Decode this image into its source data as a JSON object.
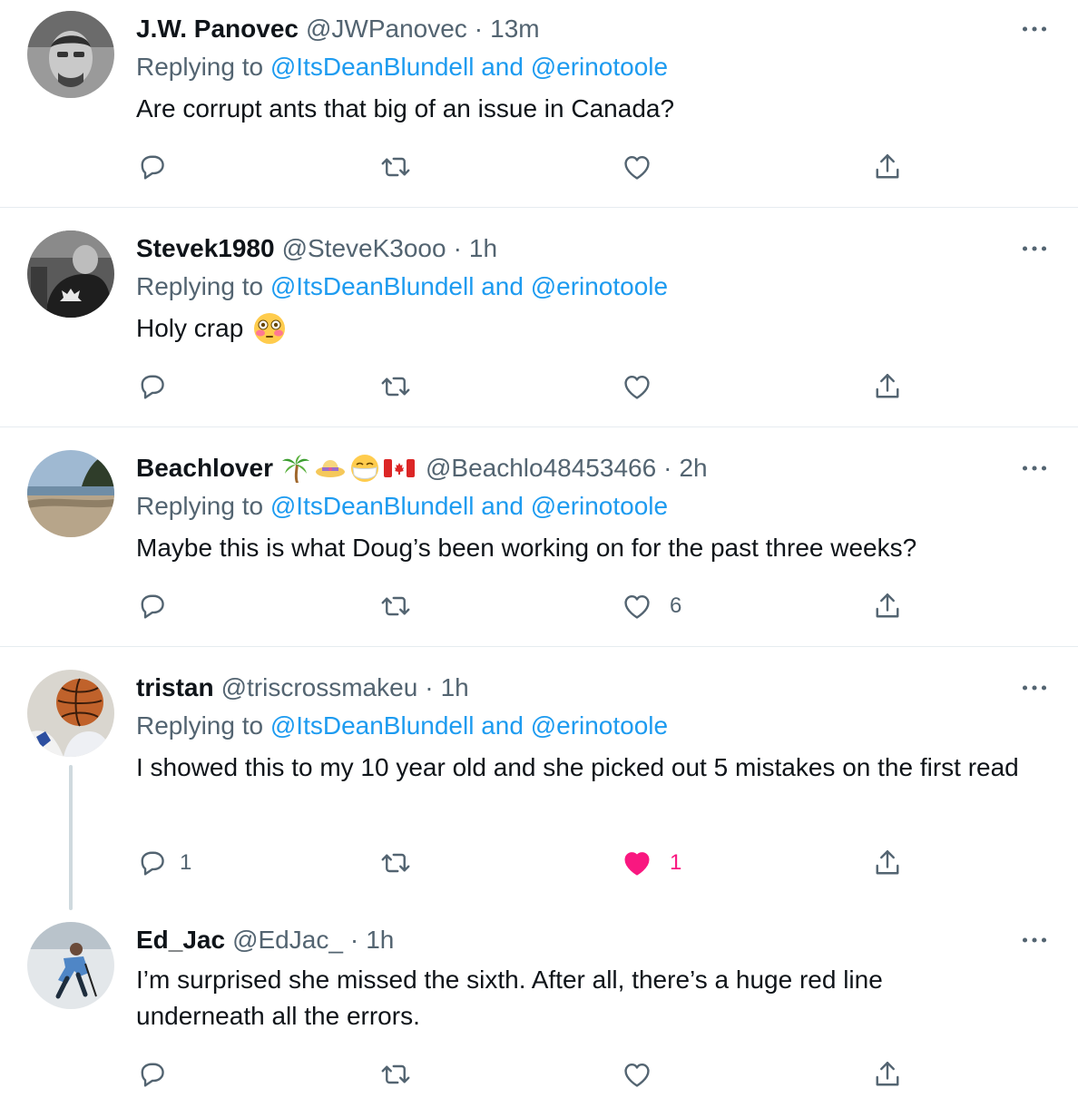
{
  "colors": {
    "link": "#1d9bf0",
    "muted": "#536471",
    "like_active": "#f91880",
    "divider": "#e6ecf0"
  },
  "tweets": [
    {
      "name": "J.W. Panovec",
      "handle": "@JWPanovec",
      "time": "13m",
      "replying_prefix": "Replying to",
      "replying_to": "@ItsDeanBlundell and @erinotoole",
      "text": "Are corrupt ants that big of an issue in Canada?",
      "reply_count": "",
      "retweet_count": "",
      "like_count": "",
      "liked": false
    },
    {
      "name": "Stevek1980",
      "handle": "@SteveK3ooo",
      "time": "1h",
      "replying_prefix": "Replying to",
      "replying_to": "@ItsDeanBlundell and @erinotoole",
      "text": "Holy crap",
      "text_emoji": "flushed-face-emoji",
      "reply_count": "",
      "retweet_count": "",
      "like_count": "",
      "liked": false
    },
    {
      "name": "Beachlover",
      "name_emojis": [
        "palm-tree-emoji",
        "sun-hat-emoji",
        "mask-face-emoji",
        "canada-flag-emoji"
      ],
      "handle": "@Beachlo48453466",
      "time": "2h",
      "replying_prefix": "Replying to",
      "replying_to": "@ItsDeanBlundell and @erinotoole",
      "text": "Maybe this is what Doug’s been working on for the past three weeks?",
      "reply_count": "",
      "retweet_count": "",
      "like_count": "6",
      "liked": false
    },
    {
      "name": "tristan",
      "handle": "@triscrossmakeu",
      "time": "1h",
      "replying_prefix": "Replying to",
      "replying_to": "@ItsDeanBlundell and @erinotoole",
      "text": "I showed this to my 10 year old and she picked out 5 mistakes on the first read",
      "reply_count": "1",
      "retweet_count": "",
      "like_count": "1",
      "liked": true
    },
    {
      "name": "Ed_Jac",
      "handle": "@EdJac_",
      "time": "1h",
      "text": "I’m surprised she missed the sixth. After all, there’s a huge red line underneath all the errors.",
      "reply_count": "",
      "retweet_count": "",
      "like_count": "",
      "liked": false
    }
  ],
  "separator": "·"
}
